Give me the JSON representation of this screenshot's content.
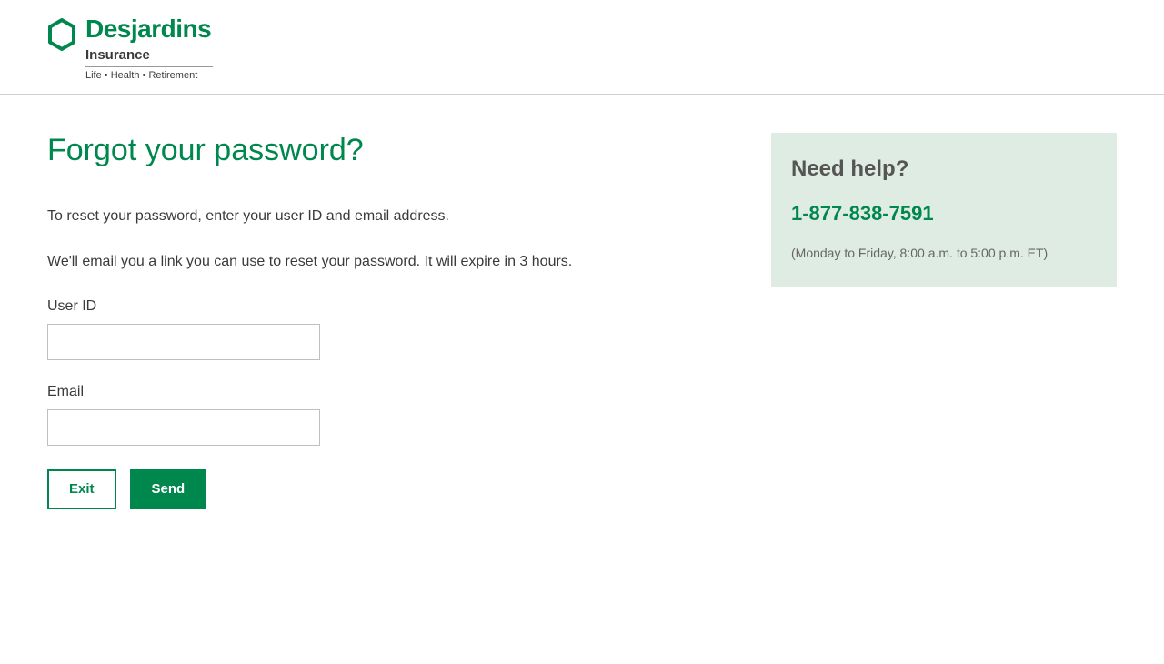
{
  "header": {
    "brand": "Desjardins",
    "subbrand": "Insurance",
    "tagline": "Life • Health • Retirement"
  },
  "main": {
    "title": "Forgot your password?",
    "instruction1": "To reset your password, enter your user ID and email address.",
    "instruction2": "We'll email you a link you can use to reset your password. It will expire in 3 hours.",
    "userIdLabel": "User ID",
    "emailLabel": "Email",
    "exitLabel": "Exit",
    "sendLabel": "Send"
  },
  "help": {
    "title": "Need help?",
    "phone": "1-877-838-7591",
    "hours": "(Monday to Friday, 8:00 a.m. to 5:00 p.m. ET)"
  },
  "colors": {
    "accent": "#00874e",
    "helpBg": "#dfece3"
  }
}
